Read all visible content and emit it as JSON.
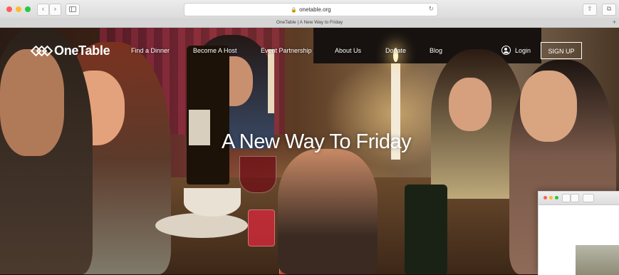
{
  "browser": {
    "url": "onetable.org",
    "tab_title": "OneTable | A New Way to Friday",
    "icons": {
      "back": "chevron-left-icon",
      "forward": "chevron-right-icon",
      "sidebar": "sidebar-icon",
      "lock": "lock-icon",
      "reload": "reload-icon",
      "share": "share-icon",
      "tabs": "tabs-icon",
      "new_tab": "plus-icon"
    },
    "glyphs": {
      "back": "‹",
      "forward": "›",
      "lock": "🔒",
      "reload": "↻",
      "share": "⇧",
      "tabs": "⧉",
      "new_tab": "+"
    }
  },
  "site": {
    "logo_text": "OneTable",
    "nav": [
      {
        "label": "Find a Dinner"
      },
      {
        "label": "Become A Host"
      },
      {
        "label": "Event Partnership"
      },
      {
        "label": "About Us"
      },
      {
        "label": "Donate"
      },
      {
        "label": "Blog"
      }
    ],
    "login_label": "Login",
    "signup_label": "SIGN UP",
    "headline": "A New Way To Friday"
  },
  "colors": {
    "close": "#fc5f57",
    "minimize": "#fdbc2e",
    "zoom": "#29c840",
    "hero_text": "#ffffff"
  }
}
